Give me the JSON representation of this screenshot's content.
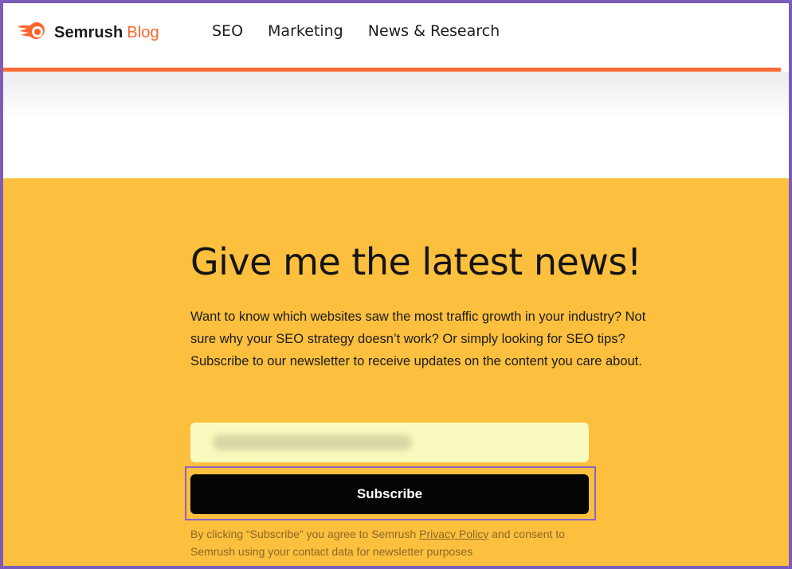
{
  "header": {
    "brand": "Semrush",
    "brand_suffix": "Blog",
    "nav": [
      {
        "label": "SEO"
      },
      {
        "label": "Marketing"
      },
      {
        "label": "News & Research"
      }
    ]
  },
  "newsletter": {
    "title": "Give me the latest news!",
    "description": "Want to know which websites saw the most traffic growth in your industry? Not sure why your SEO strategy doesn’t work? Or simply looking for SEO tips? Subscribe to our newsletter to receive updates on the content you care about.",
    "email_value": "",
    "subscribe_label": "Subscribe",
    "legal_prefix": "By clicking “Subscribe” you agree to Semrush ",
    "legal_link": "Privacy Policy",
    "legal_suffix": " and consent to Semrush using your contact data for newsletter purposes"
  },
  "colors": {
    "accent": "#ff642d",
    "newsletter_bg": "#fcbf3e",
    "input_bg": "#f8fbbd",
    "button_bg": "#050505",
    "highlight": "#8a63c9"
  }
}
